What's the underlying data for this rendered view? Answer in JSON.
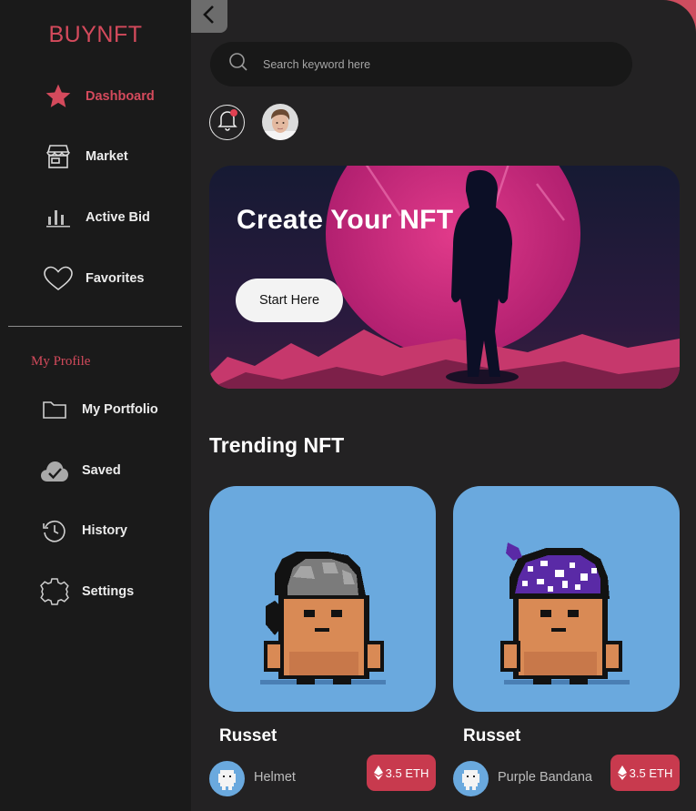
{
  "brand": "BUYNFT",
  "nav": [
    {
      "label": "Dashboard",
      "icon": "star-icon",
      "active": true
    },
    {
      "label": "Market",
      "icon": "store-icon"
    },
    {
      "label": "Active Bid",
      "icon": "bar-chart-icon"
    },
    {
      "label": "Favorites",
      "icon": "heart-icon"
    }
  ],
  "profile_section": {
    "title": "My Profile",
    "items": [
      {
        "label": "My Portfolio",
        "icon": "folder-icon"
      },
      {
        "label": "Saved",
        "icon": "cloud-check-icon"
      },
      {
        "label": "History",
        "icon": "history-icon"
      },
      {
        "label": "Settings",
        "icon": "gear-icon"
      }
    ]
  },
  "search": {
    "placeholder": "Search keyword here"
  },
  "banner": {
    "title": "Create Your NFT",
    "button": "Start Here"
  },
  "trending": {
    "title": "Trending NFT",
    "cards": [
      {
        "name": "Russet",
        "owner": "Helmet",
        "price": "3.5 ETH",
        "hat": "helmet"
      },
      {
        "name": "Russet",
        "owner": "Purple Bandana",
        "price": "3.5 ETH",
        "hat": "bandana"
      }
    ]
  },
  "colors": {
    "accent": "#d44a5c",
    "background": "#232223",
    "sidebar": "#1a1a1a",
    "card": "#6aa9de",
    "price": "#c83a4e"
  }
}
